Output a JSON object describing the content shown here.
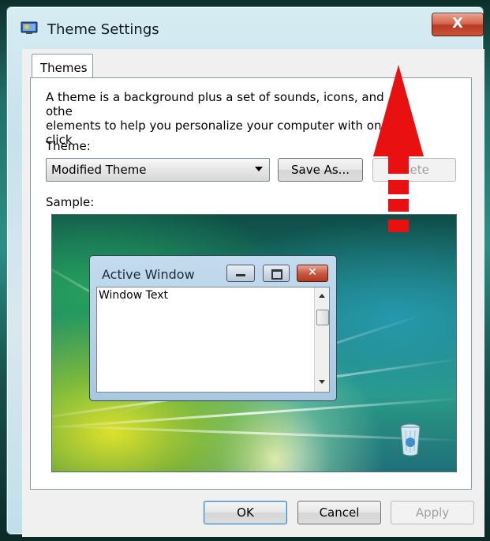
{
  "window": {
    "title": "Theme Settings",
    "close_label": "X"
  },
  "tabs": [
    {
      "label": "Themes",
      "selected": true
    }
  ],
  "themes_panel": {
    "description_line1": "A theme is a background plus a set of sounds, icons, and othe",
    "description_line2": "elements to help you personalize your computer with one click",
    "theme_label": "Theme:",
    "theme_selected": "Modified Theme",
    "save_as_label": "Save As...",
    "delete_label": "elete",
    "sample_label": "Sample:"
  },
  "sample_preview": {
    "active_window_title": "Active Window",
    "window_text": "Window Text"
  },
  "footer": {
    "ok_label": "OK",
    "cancel_label": "Cancel",
    "apply_label": "Apply"
  },
  "colors": {
    "annotation_arrow": "#e81010",
    "close_button": "#c9553b",
    "default_button_border": "#3c7fb1"
  }
}
